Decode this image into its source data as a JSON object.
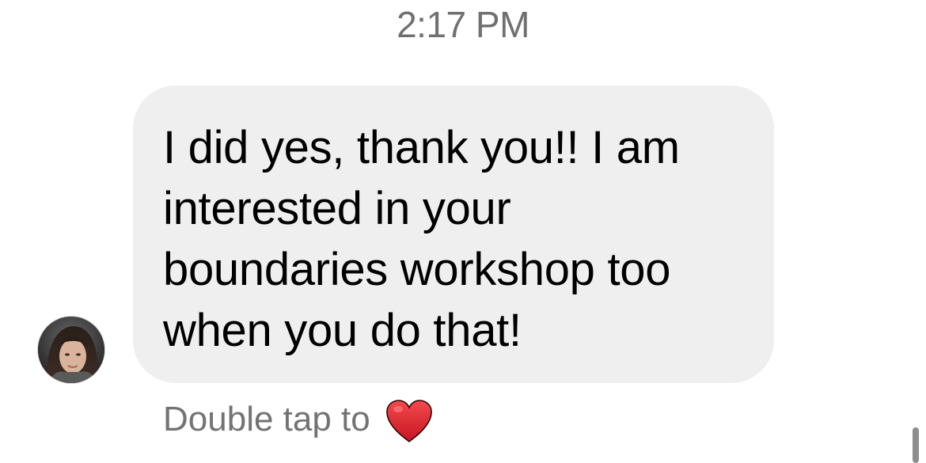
{
  "thread": {
    "timestamp": "2:17 PM",
    "message": {
      "text": "I did yes, thank you!! I am interested in your boundaries workshop too when you do that!",
      "lines": [
        "I did yes, thank you!! I am",
        "interested in your",
        "boundaries workshop too",
        "when you do that!"
      ]
    },
    "reaction_hint": {
      "label": "Double tap to",
      "icon": "heart-icon"
    }
  },
  "colors": {
    "bubble_background": "#efefef",
    "timestamp_text": "#707070",
    "hint_text": "#737373",
    "heart": "#e0202b"
  }
}
